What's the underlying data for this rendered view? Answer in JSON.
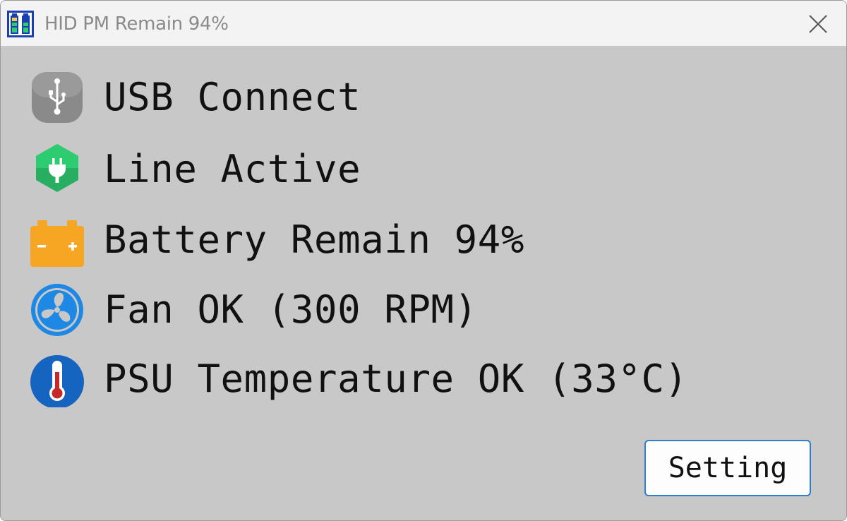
{
  "window": {
    "title": "HID PM Remain 94%"
  },
  "status_items": [
    {
      "label": "USB Connect",
      "icon": "usb-icon",
      "color": "#8a8a8a"
    },
    {
      "label": "Line Active",
      "icon": "plug-icon",
      "color": "#27ae60"
    },
    {
      "label": "Battery Remain 94%",
      "icon": "battery-icon",
      "color": "#f6a623"
    },
    {
      "label": "Fan OK (300 RPM)",
      "icon": "fan-icon",
      "color": "#1e88e5"
    },
    {
      "label": "PSU Temperature OK (33°C)",
      "icon": "thermometer-icon",
      "color": "#1565c0"
    }
  ],
  "setting_button": {
    "label": "Setting"
  }
}
